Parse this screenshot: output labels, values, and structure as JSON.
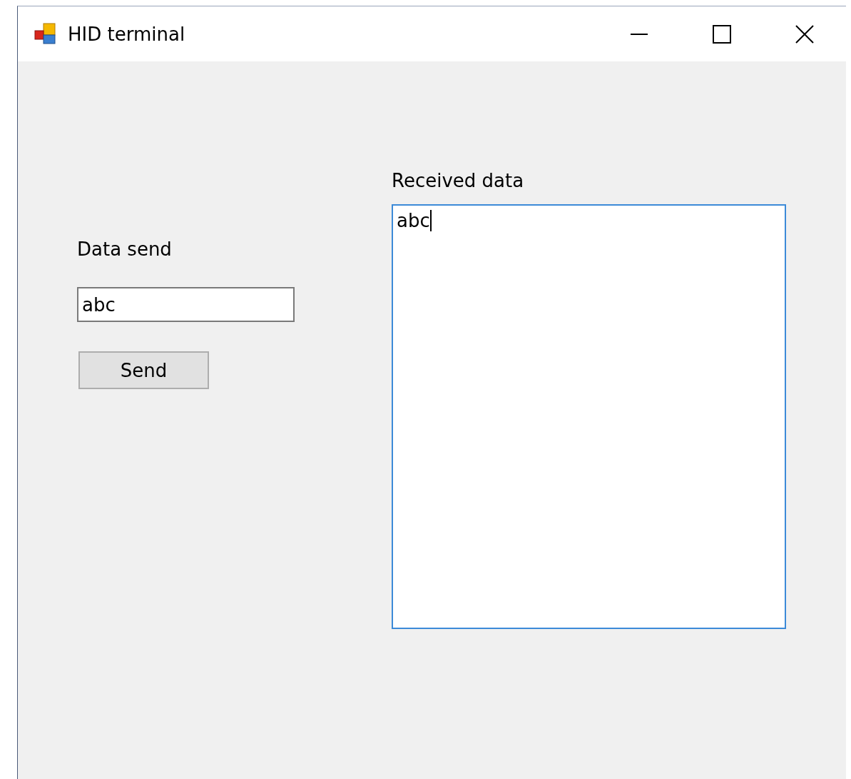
{
  "window": {
    "title": "HID terminal"
  },
  "send": {
    "label": "Data send",
    "value": "abc",
    "button": "Send"
  },
  "received": {
    "label": "Received data",
    "value": "abc",
    "focused": true
  }
}
